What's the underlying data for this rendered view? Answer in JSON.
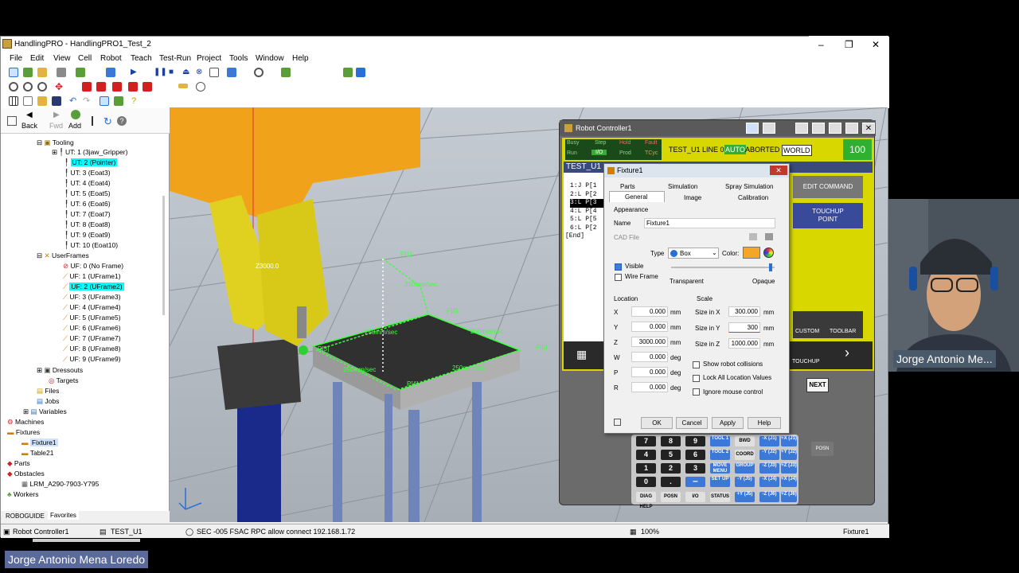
{
  "window": {
    "title": "HandlingPRO - HandlingPRO1_Test_2",
    "ctl_min": "–",
    "ctl_max": "❐",
    "ctl_close": "✕"
  },
  "menu": [
    "File",
    "Edit",
    "View",
    "Cell",
    "Robot",
    "Teach",
    "Test-Run",
    "Project",
    "Tools",
    "Window",
    "Help"
  ],
  "nav": {
    "back": "Back",
    "fwd": "Fwd",
    "add": "Add"
  },
  "tree": {
    "tooling": "Tooling",
    "ut": [
      "UT: 1  (3jaw_Gripper)",
      "UT: 2  (Pointer)",
      "UT: 3  (Eoat3)",
      "UT: 4  (Eoat4)",
      "UT: 5  (Eoat5)",
      "UT: 6  (Eoat6)",
      "UT: 7  (Eoat7)",
      "UT: 8  (Eoat8)",
      "UT: 9  (Eoat9)",
      "UT: 10  (Eoat10)"
    ],
    "userframes": "UserFrames",
    "uf": [
      "UF: 0  (No Frame)",
      "UF: 1  (UFrame1)",
      "UF: 2  (UFrame2)",
      "UF: 3  (UFrame3)",
      "UF: 4  (UFrame4)",
      "UF: 5  (UFrame5)",
      "UF: 6  (UFrame6)",
      "UF: 7  (UFrame7)",
      "UF: 8  (UFrame8)",
      "UF: 9  (UFrame9)"
    ],
    "dressouts": "Dressouts",
    "targets": "Targets",
    "files": "Files",
    "jobs": "Jobs",
    "variables": "Variables",
    "machines": "Machines",
    "fixtures": "Fixtures",
    "fixture1": "Fixture1",
    "table21": "Table21",
    "parts": "Parts",
    "obstacles": "Obstacles",
    "obstacle1": "LRM_A290-7903-Y795",
    "workers": "Workers"
  },
  "left_tabs": {
    "roboguide": "ROBOGUIDE",
    "favorites": "Favorites"
  },
  "status": {
    "controller": "Robot Controller1",
    "program": "TEST_U1",
    "message": "SEC -005 FSAC RPC  allow connect  192.168.1.72",
    "zoom": "100%",
    "selected": "Fixture1"
  },
  "scene": {
    "labels": {
      "p1": "P[1]",
      "p2": "P[2]",
      "p3": "P[3]",
      "p4": "P[4]",
      "p5": "P[5]",
      "speed1": "250mm/sec",
      "speed2": "250mm/sec",
      "speed3": "250mm/sec",
      "speed4": "250mm/sec",
      "speed5": "250mm/sec",
      "z3000": "Z3000.0"
    }
  },
  "rc": {
    "title": "Robot Controller1",
    "status_top": [
      "Busy",
      "Step",
      "Hold",
      "Fault"
    ],
    "status_bot": [
      "Run",
      "I/O",
      "Prod",
      "TCyc"
    ],
    "line": "TEST_U1 LINE 0",
    "auto": "AUTO",
    "aborted": "ABORTED",
    "world": "WORLD",
    "override": "100",
    "prog_title": "TEST_U1",
    "prog_lines": [
      "1:J  P[1",
      "2:L  P[2",
      "3:L  P[3",
      "4:L  P[4",
      "5:L  P[5",
      "6:L  P[2"
    ],
    "prog_end": "[End]",
    "edit_command": "EDIT COMMAND",
    "touchup_point": "TOUCHUP POINT",
    "custom": "CUSTOM",
    "toolbar": "TOOLBAR",
    "touchup": "TOUCHUP",
    "next": "NEXT",
    "posn": "POSN",
    "keys_num": [
      "7",
      "8",
      "9",
      "4",
      "5",
      "6",
      "1",
      "2",
      "3",
      "0",
      "."
    ],
    "keys_func": [
      "TOOL 1",
      "TOOL 2",
      "MOVE MENU",
      "SET UP",
      "I/O",
      "STATUS"
    ],
    "keys_gray": [
      "BWD",
      "COORD",
      "GROUP",
      "POSN",
      "DIAG HELP"
    ],
    "keys_jog": [
      "-X (J1)",
      "+X (J1)",
      "-Y (J2)",
      "+Y (J2)",
      "-Z (J3)",
      "+Z (J3)",
      "-X (J4)",
      "+X (J4)",
      "-Y (J5)",
      "+Y (J5)",
      "-Z (J6)",
      "+Z (J6)"
    ]
  },
  "dialog": {
    "title": "Fixture1",
    "tabs_row1": [
      "Parts",
      "Simulation",
      "Spray Simulation"
    ],
    "tabs_row2": [
      "General",
      "Image",
      "Calibration"
    ],
    "appearance": "Appearance",
    "name_label": "Name",
    "name_value": "Fixture1",
    "cad_file": "CAD File",
    "type_label": "Type",
    "type_value": "Box",
    "color_label": "Color:",
    "color_value": "#f5a623",
    "visible": "Visible",
    "wireframe": "Wire Frame",
    "transparent": "Transparent",
    "opaque": "Opaque",
    "location": "Location",
    "loc": [
      {
        "axis": "X",
        "value": "0.000",
        "unit": "mm"
      },
      {
        "axis": "Y",
        "value": "0.000",
        "unit": "mm"
      },
      {
        "axis": "Z",
        "value": "3000.000",
        "unit": "mm"
      },
      {
        "axis": "W",
        "value": "0.000",
        "unit": "deg"
      },
      {
        "axis": "P",
        "value": "0.000",
        "unit": "deg"
      },
      {
        "axis": "R",
        "value": "0.000",
        "unit": "deg"
      }
    ],
    "scale": "Scale",
    "size": [
      {
        "label": "Size in X",
        "value": "300.000",
        "unit": "mm"
      },
      {
        "label": "Size in Y",
        "value": "300",
        "unit": "mm"
      },
      {
        "label": "Size in Z",
        "value": "1000.000",
        "unit": "mm"
      }
    ],
    "show_collisions": "Show robot collisions",
    "lock_all": "Lock All Location Values",
    "ignore_mouse": "Ignore mouse control",
    "ok": "OK",
    "cancel": "Cancel",
    "apply": "Apply",
    "help": "Help"
  },
  "webcam": {
    "name": "Jorge Antonio Me..."
  },
  "speaker": {
    "name": "Jorge Antonio Mena Loredo"
  }
}
